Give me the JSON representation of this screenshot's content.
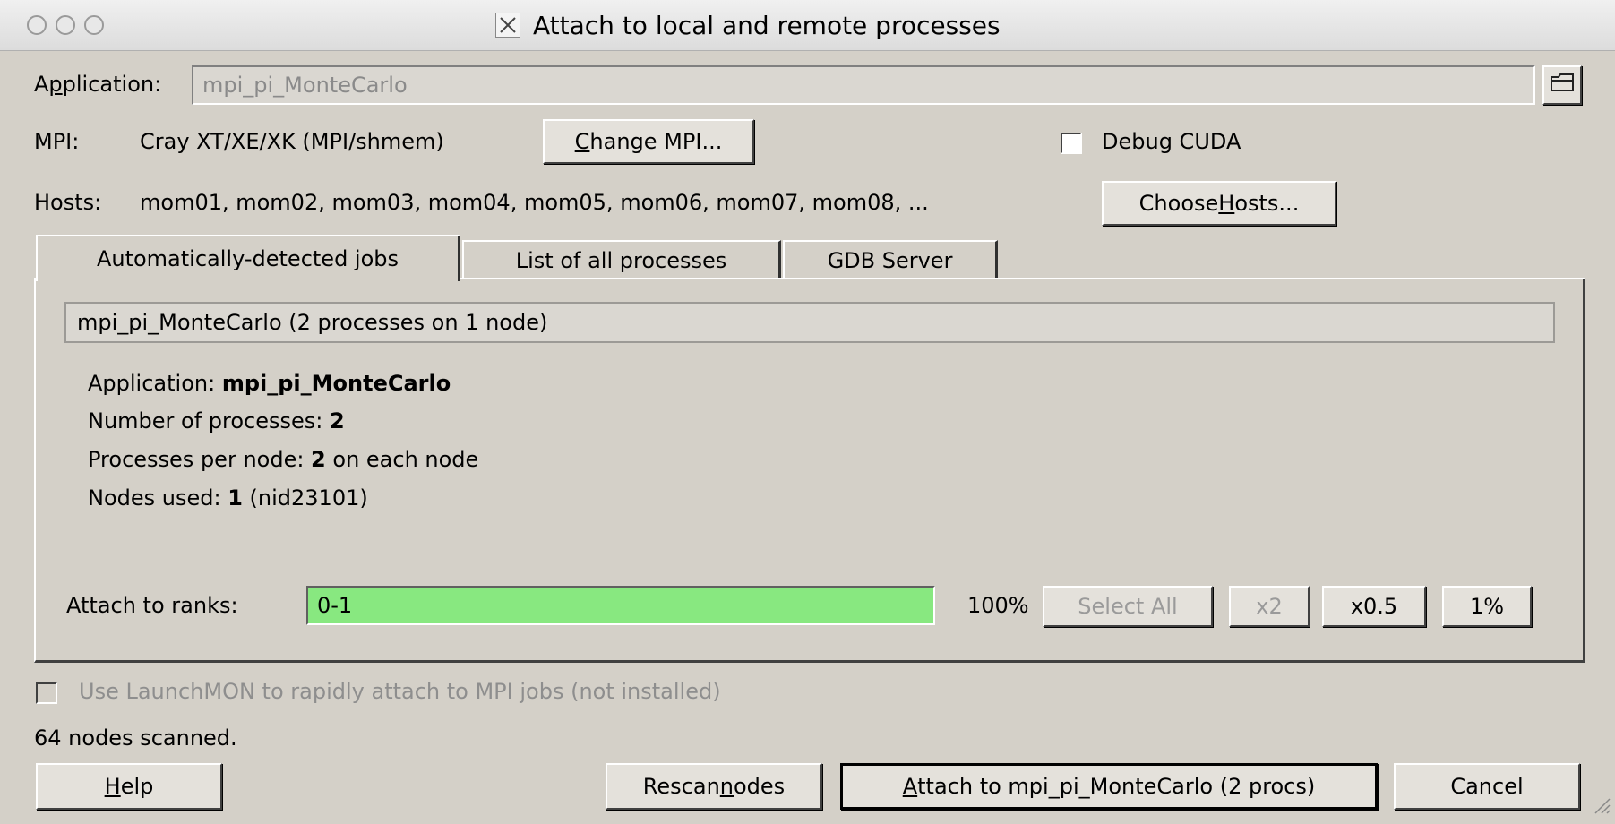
{
  "window": {
    "title": "Attach to local and remote processes"
  },
  "application": {
    "label_pre": "A",
    "label_u": "p",
    "label_post": "plication:",
    "value": "mpi_pi_MonteCarlo"
  },
  "mpi": {
    "label": "MPI:",
    "value": "Cray XT/XE/XK (MPI/shmem)",
    "change_button_u": "C",
    "change_button_rest": "hange MPI..."
  },
  "debug_cuda": {
    "label": "Debug CUDA",
    "checked": false
  },
  "hosts": {
    "label": "Hosts:",
    "value": "mom01, mom02, mom03, mom04, mom05, mom06, mom07, mom08, ...",
    "choose_button_pre": "Choose ",
    "choose_button_u": "H",
    "choose_button_post": "osts..."
  },
  "tabs": [
    {
      "label": "Automatically-detected jobs",
      "active": true
    },
    {
      "label": "List of all processes",
      "active": false
    },
    {
      "label": "GDB Server",
      "active": false
    }
  ],
  "job": {
    "summary": "mpi_pi_MonteCarlo (2 processes on 1 node)",
    "application_label": "Application: ",
    "application_value": "mpi_pi_MonteCarlo",
    "num_processes_label": "Number of processes: ",
    "num_processes_value": "2",
    "ppn_label": "Processes per node: ",
    "ppn_value": "2",
    "ppn_suffix": " on each node",
    "nodes_label": "Nodes used: ",
    "nodes_value": "1",
    "nodes_suffix": " (nid23101)"
  },
  "ranks": {
    "label": "Attach to ranks:",
    "value": "0-1",
    "percent": "100%",
    "select_all": "Select All",
    "x2": "x2",
    "x05": "x0.5",
    "one_percent": "1%",
    "field_color": "#88e880"
  },
  "launchmon": {
    "label": "Use LaunchMON to rapidly attach to MPI jobs (not installed)",
    "checked": false,
    "disabled": true
  },
  "status": "64 nodes scanned.",
  "buttons": {
    "help_u": "H",
    "help_rest": "elp",
    "rescan_pre": "Rescan ",
    "rescan_u": "n",
    "rescan_post": "odes",
    "attach_u": "A",
    "attach_rest": "ttach to mpi_pi_MonteCarlo (2 procs)",
    "cancel": "Cancel"
  }
}
